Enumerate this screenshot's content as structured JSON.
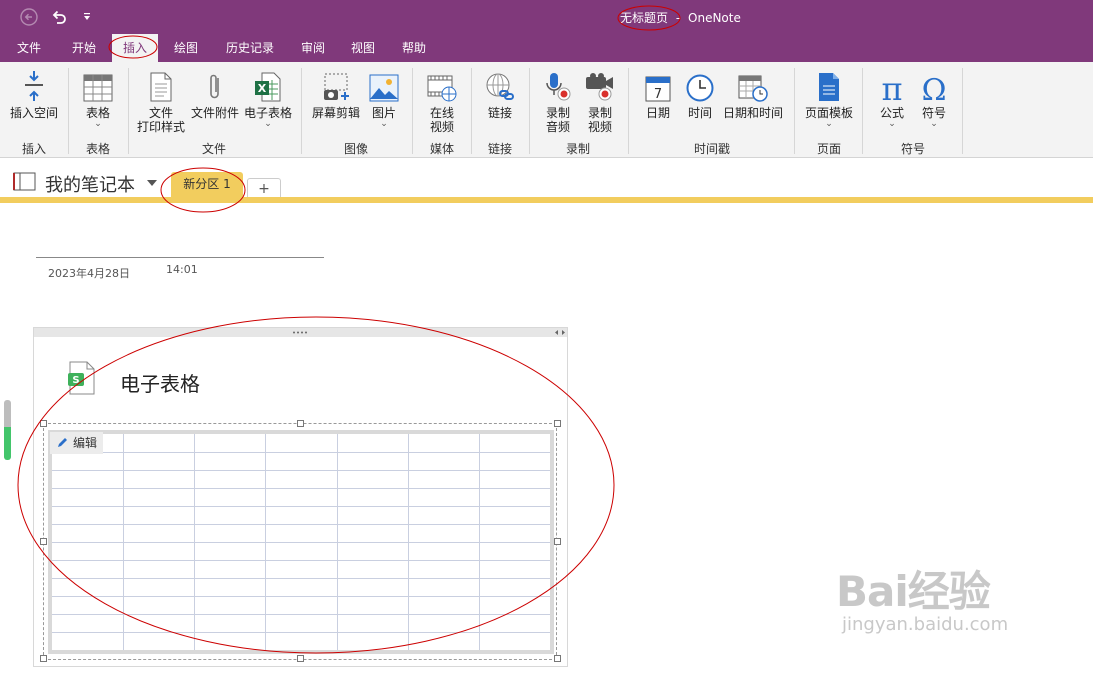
{
  "titlebar": {
    "page_title": "无标题页",
    "separator": "-",
    "app_name": "OneNote"
  },
  "menu": {
    "tabs": [
      "文件",
      "开始",
      "插入",
      "绘图",
      "历史记录",
      "审阅",
      "视图",
      "帮助"
    ],
    "active": "插入"
  },
  "ribbon": {
    "buttons": {
      "insert_space": "插入空间",
      "table": "表格",
      "file_printout_line1": "文件",
      "file_printout_line2": "打印样式",
      "file_attachment": "文件附件",
      "spreadsheet": "电子表格",
      "screen_clipping": "屏幕剪辑",
      "picture": "图片",
      "online_video_line1": "在线",
      "online_video_line2": "视频",
      "link": "链接",
      "record_audio_line1": "录制",
      "record_audio_line2": "音频",
      "record_video_line1": "录制",
      "record_video_line2": "视频",
      "date": "日期",
      "time": "时间",
      "date_time": "日期和时间",
      "page_templates": "页面模板",
      "equation": "公式",
      "symbol": "符号"
    },
    "groups": {
      "insert": "插入",
      "tables": "表格",
      "files": "文件",
      "images": "图像",
      "media": "媒体",
      "links": "链接",
      "recording": "录制",
      "timestamp": "时间戳",
      "pages": "页面",
      "symbols": "符号"
    }
  },
  "notebook": {
    "name": "我的笔记本",
    "section_tab": "新分区 1",
    "add_tab": "+"
  },
  "page": {
    "date": "2023年4月28日",
    "time": "14:01",
    "file_title": "电子表格",
    "edit_label": "编辑",
    "spreadsheet_rows": 12,
    "spreadsheet_cols": 7
  },
  "watermark": {
    "logo_text": "Bai经验",
    "url": "jingyan.baidu.com"
  },
  "colors": {
    "brand": "#80397b",
    "section": "#f2cd5e",
    "annotation": "#cc0000"
  }
}
